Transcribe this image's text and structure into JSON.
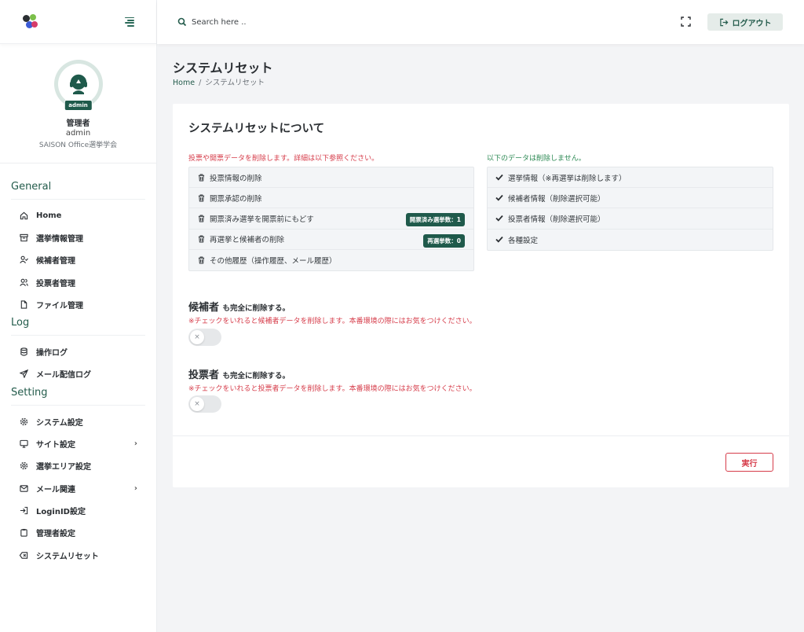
{
  "sidebar": {
    "profile": {
      "badge": "admin",
      "name": "管理者",
      "id": "admin",
      "org": "SAISON Office選挙学会"
    },
    "sections": [
      {
        "title": "General"
      },
      {
        "title": "Log"
      },
      {
        "title": "Setting"
      }
    ],
    "general_items": [
      {
        "label": "Home",
        "icon": "home-icon"
      },
      {
        "label": "選挙情報管理",
        "icon": "archive-icon"
      },
      {
        "label": "候補者管理",
        "icon": "user-check-icon"
      },
      {
        "label": "投票者管理",
        "icon": "users-icon"
      },
      {
        "label": "ファイル管理",
        "icon": "file-icon"
      }
    ],
    "log_items": [
      {
        "label": "操作ログ",
        "icon": "database-icon"
      },
      {
        "label": "メール配信ログ",
        "icon": "send-icon"
      }
    ],
    "setting_items": [
      {
        "label": "システム設定",
        "icon": "gear-icon"
      },
      {
        "label": "サイト設定",
        "icon": "monitor-icon",
        "has_submenu": true
      },
      {
        "label": "選挙エリア設定",
        "icon": "gear-icon"
      },
      {
        "label": "メール関連",
        "icon": "mail-icon",
        "has_submenu": true
      },
      {
        "label": "LoginID設定",
        "icon": "login-icon"
      },
      {
        "label": "管理者設定",
        "icon": "clipboard-icon"
      },
      {
        "label": "システムリセット",
        "icon": "backspace-icon"
      }
    ]
  },
  "topbar": {
    "search_placeholder": "Search here ..",
    "logout_label": "ログアウト"
  },
  "page": {
    "title": "システムリセット",
    "breadcrumb": {
      "home": "Home",
      "separator": "/",
      "current": "システムリセット"
    }
  },
  "card": {
    "title": "システムリセットについて",
    "delete_heading": "投票や開票データを削除します。詳細は以下参照ください。",
    "delete_items": [
      {
        "label": "投票情報の削除"
      },
      {
        "label": "開票承認の削除"
      },
      {
        "label": "開票済み選挙を開票前にもどす",
        "badge": "開票済み選挙数：1"
      },
      {
        "label": "再選挙と候補者の削除",
        "badge": "再選挙数：0"
      },
      {
        "label": "その他履歴（操作履歴、メール履歴）"
      }
    ],
    "keep_heading": "以下のデータは削除しません。",
    "keep_items": [
      {
        "label": "選挙情報（※再選挙は削除します）"
      },
      {
        "label": "候補者情報（削除選択可能）"
      },
      {
        "label": "投票者情報（削除選択可能）"
      },
      {
        "label": "各種設定"
      }
    ],
    "options": [
      {
        "title": "候補者",
        "suffix": "も完全に削除する。",
        "warning": "※チェックをいれると候補者データを削除します。本番環境の際にはお気をつけください。",
        "toggle_mark": "×",
        "checked": false
      },
      {
        "title": "投票者",
        "suffix": "も完全に削除する。",
        "warning": "※チェックをいれると投票者データを削除します。本番環境の際にはお気をつけください。",
        "toggle_mark": "×",
        "checked": false
      }
    ],
    "execute_label": "実行"
  },
  "colors": {
    "brand_green": "#245c4c",
    "badge_green": "#1f5a4b",
    "danger_red": "#d63c4a",
    "keep_green": "#2e8a55"
  }
}
